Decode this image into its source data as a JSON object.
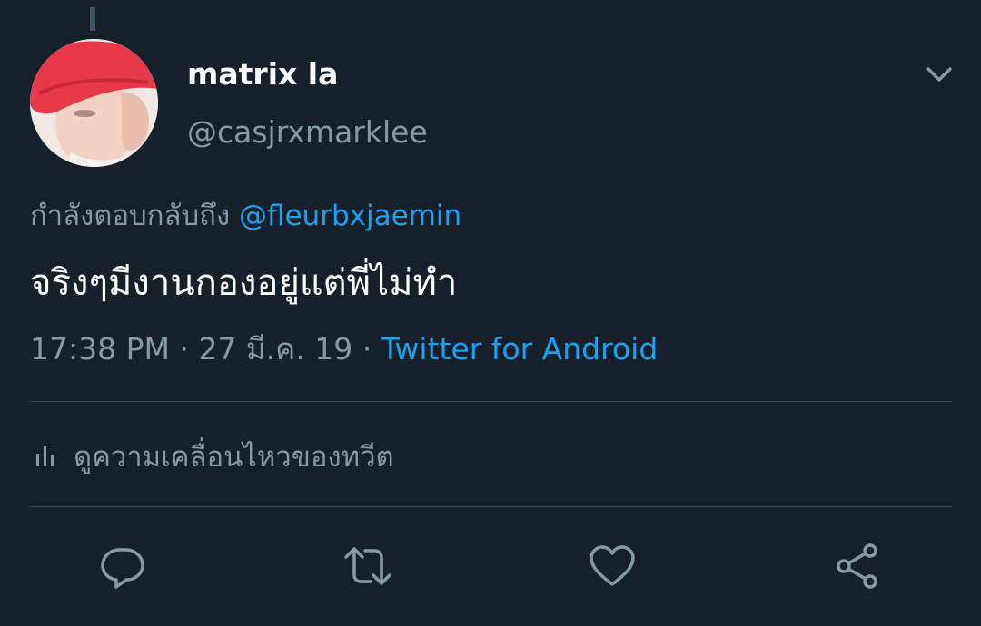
{
  "tweet": {
    "display_name": "matrix la",
    "handle": "@casjrxmarklee",
    "reply_prefix": "กำลังตอบกลับถึง ",
    "reply_mention": "@fleurbxjaemin",
    "text": "จริงๆมีงานกองอยู่แต่พี่ไม่ทำ",
    "time": "17:38 PM",
    "date": "27 มี.ค. 19",
    "separator": " · ",
    "source": "Twitter for Android"
  },
  "analytics": {
    "label": "ดูความเคลื่อนไหวของทวีต",
    "icon": "bar-chart-icon"
  },
  "actions": [
    {
      "name": "reply",
      "icon": "reply-icon"
    },
    {
      "name": "retweet",
      "icon": "retweet-icon"
    },
    {
      "name": "like",
      "icon": "heart-icon"
    },
    {
      "name": "share",
      "icon": "share-icon"
    }
  ],
  "colors": {
    "background": "#15202b",
    "primary_text": "#ffffff",
    "secondary_text": "#8899a6",
    "accent": "#1da1f2",
    "divider": "#38444d"
  }
}
